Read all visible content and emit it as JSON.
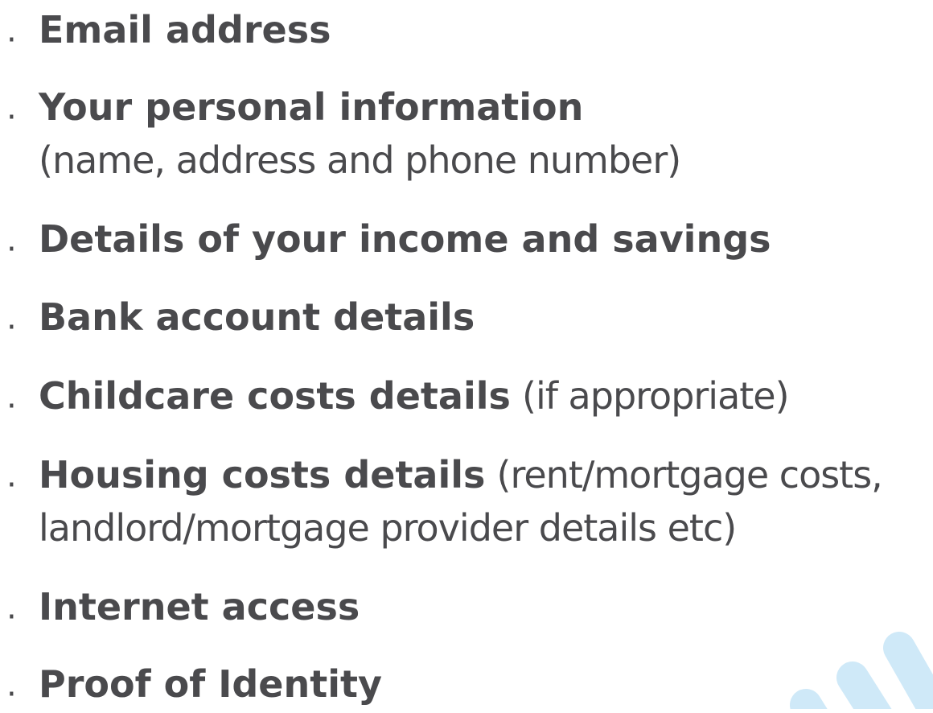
{
  "items": [
    {
      "bold": "Email address"
    },
    {
      "bold": "Your personal information",
      "note_line": "(name, address and phone number)"
    },
    {
      "bold": "Details of your income and savings"
    },
    {
      "bold": "Bank account details"
    },
    {
      "bold": "Childcare costs details",
      "inline_note": "(if appropriate)"
    },
    {
      "bold": "Housing costs details",
      "inline_note": "(rent/mortgage costs,",
      "note_line": "landlord/mortgage provider details etc)"
    },
    {
      "bold": "Internet access"
    },
    {
      "bold": "Proof of Identity"
    }
  ],
  "bullet_char": "·",
  "colors": {
    "text": "#4a4a4d",
    "accent_decoration": "#cfe9f8",
    "background": "#ffffff"
  }
}
